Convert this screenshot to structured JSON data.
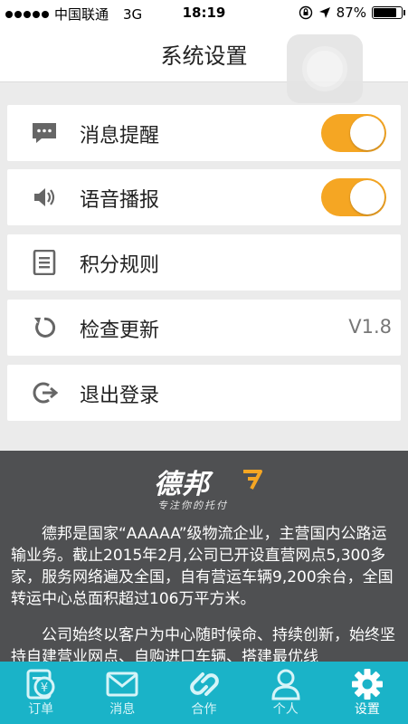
{
  "status_bar": {
    "carrier": "中国联通",
    "network": "3G",
    "time": "18:19",
    "battery": "87%",
    "battery_level": 0.87
  },
  "header": {
    "title": "系统设置"
  },
  "settings": {
    "items": [
      {
        "label": "消息提醒",
        "icon": "message-icon",
        "toggle": true
      },
      {
        "label": "语音播报",
        "icon": "speaker-icon",
        "toggle": true
      },
      {
        "label": "积分规则",
        "icon": "document-icon"
      },
      {
        "label": "检查更新",
        "icon": "refresh-icon",
        "value": "V1.8"
      },
      {
        "label": "退出登录",
        "icon": "logout-icon"
      }
    ]
  },
  "about": {
    "brand": "德邦",
    "slogan": "专注你的托付",
    "paragraphs": [
      "德邦是国家“AAAAA”级物流企业，主营国内公路运输业务。截止2015年2月,公司已开设直营网点5,300多家，服务网络遍及全国，自有营运车辆9,200余台，全国转运中心总面积超过106万平方米。",
      "公司始终以客户为中心随时候命、持续创新，始终坚持自建营业网点、自购进口车辆、搭建最优线"
    ]
  },
  "tabbar": {
    "tabs": [
      {
        "label": "订单",
        "icon": "order-icon"
      },
      {
        "label": "消息",
        "icon": "mail-icon"
      },
      {
        "label": "合作",
        "icon": "cooperation-icon"
      },
      {
        "label": "个人",
        "icon": "person-icon"
      },
      {
        "label": "设置",
        "icon": "gear-icon",
        "active": true
      }
    ]
  },
  "colors": {
    "accent": "#f5a623",
    "tabbar": "#1ab3c8",
    "about_bg": "#4f5052"
  }
}
